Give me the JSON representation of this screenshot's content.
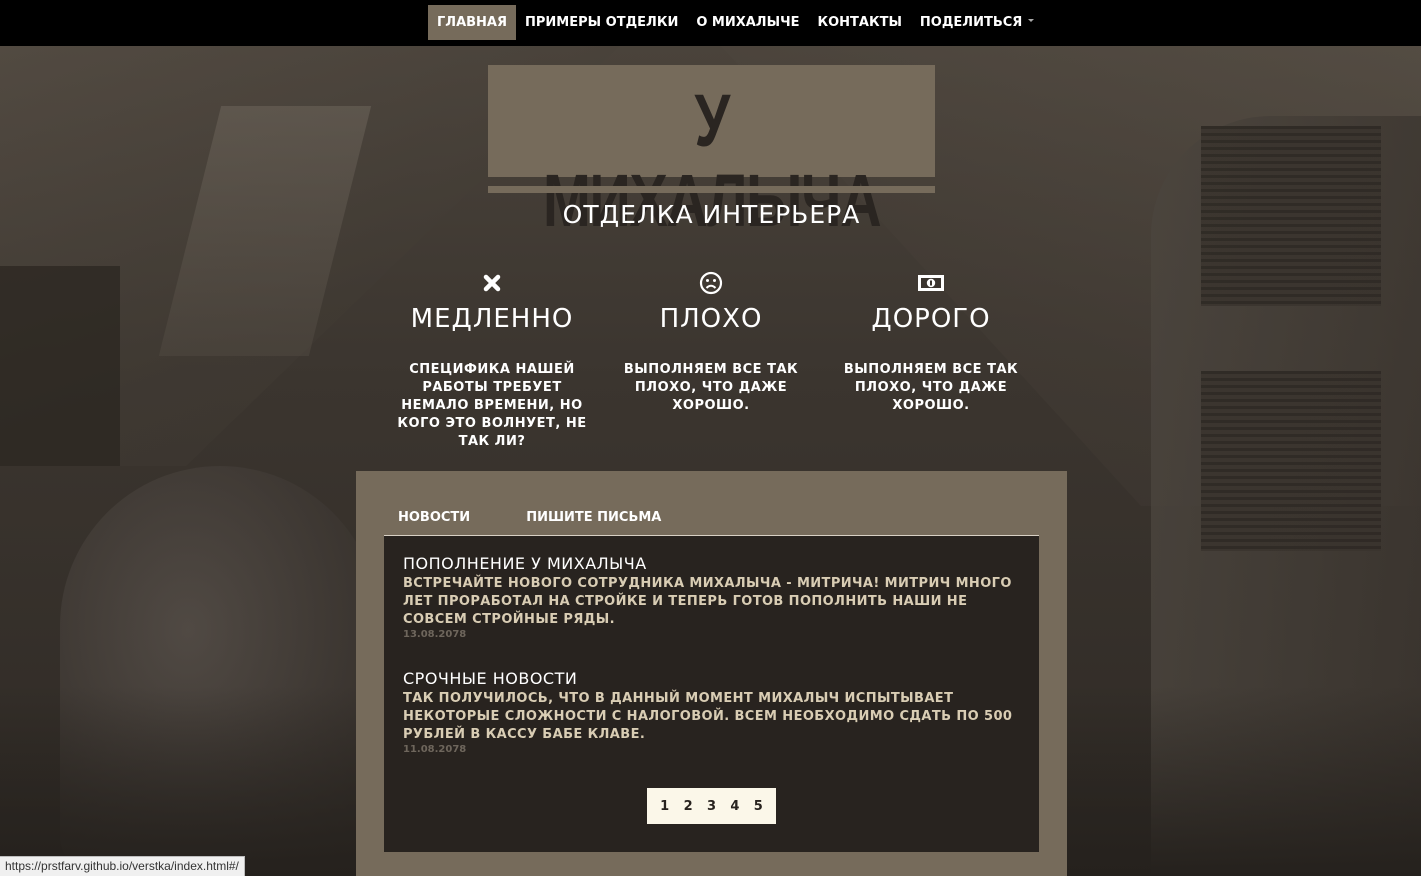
{
  "nav": {
    "items": [
      {
        "label": "ГЛАВНАЯ",
        "active": true
      },
      {
        "label": "ПРИМЕРЫ ОТДЕЛКИ",
        "active": false
      },
      {
        "label": "О МИХАЛЫЧЕ",
        "active": false
      },
      {
        "label": "КОНТАКТЫ",
        "active": false
      },
      {
        "label": "ПОДЕЛИТЬСЯ",
        "active": false,
        "dropdown": true
      }
    ]
  },
  "brand": {
    "logo_text": "У МИХАЛЫЧА",
    "subtitle": "ОТДЕЛКА ИНТЕРЬЕРА"
  },
  "features": [
    {
      "icon": "close-icon",
      "title": "МЕДЛЕННО",
      "text": "СПЕЦИФИКА НАШЕЙ РАБОТЫ ТРЕБУЕТ НЕМАЛО ВРЕМЕНИ, НО КОГО ЭТО ВОЛНУЕТ, НЕ ТАК ЛИ?"
    },
    {
      "icon": "sad-face-icon",
      "title": "ПЛОХО",
      "text": "ВЫПОЛНЯЕМ ВСЕ ТАК ПЛОХО, ЧТО ДАЖЕ ХОРОШО."
    },
    {
      "icon": "money-icon",
      "title": "ДОРОГО",
      "text": "ВЫПОЛНЯЕМ ВСЕ ТАК ПЛОХО, ЧТО ДАЖЕ ХОРОШО."
    }
  ],
  "tabs": {
    "news": "НОВОСТИ",
    "letters": "ПИШИТЕ ПИСЬМА"
  },
  "news": [
    {
      "title": "ПОПОЛНЕНИЕ У МИХАЛЫЧА",
      "text": "ВСТРЕЧАЙТЕ НОВОГО СОТРУДНИКА МИХАЛЫЧА - МИТРИЧА! МИТРИЧ МНОГО ЛЕТ ПРОРАБОТАЛ НА СТРОЙКЕ И ТЕПЕРЬ ГОТОВ ПОПОЛНИТЬ НАШИ НЕ СОВСЕМ СТРОЙНЫЕ РЯДЫ.",
      "date": "13.08.2078"
    },
    {
      "title": "СРОЧНЫЕ НОВОСТИ",
      "text": "ТАК ПОЛУЧИЛОСЬ, ЧТО В ДАННЫЙ МОМЕНТ МИХАЛЫЧ ИСПЫТЫВАЕТ НЕКОТОРЫЕ СЛОЖНОСТИ С НАЛОГОВОЙ. ВСЕМ НЕОБХОДИМО СДАТЬ ПО 500 РУБЛЕЙ В КАССУ БАБЕ КЛАВЕ.",
      "date": "11.08.2078"
    }
  ],
  "pager": [
    "1",
    "2",
    "3",
    "4",
    "5"
  ],
  "status_url": "https://prstfarv.github.io/verstka/index.html#/",
  "colors": {
    "accent": "#766b5b",
    "nav_bg": "#000000",
    "news_bg": "#28231f",
    "news_text": "#d9cdb4",
    "pager_bg": "#fbf7e9"
  }
}
